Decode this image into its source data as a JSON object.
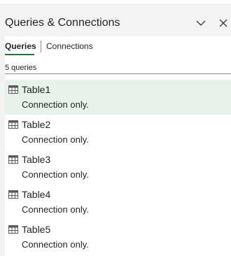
{
  "pane": {
    "title": "Queries & Connections",
    "collapse_icon": "chevron-down-icon",
    "close_icon": "close-icon"
  },
  "tabs": {
    "active": "Queries",
    "items": [
      {
        "label": "Queries"
      },
      {
        "label": "Connections"
      }
    ]
  },
  "query_count": "5 queries",
  "colors": {
    "accent": "#217346",
    "selected_bg": "#e6f2ea",
    "icon": "#5a5a5a"
  },
  "queries": [
    {
      "name": "Table1",
      "description": "Connection only.",
      "icon": "table-icon",
      "selected": true
    },
    {
      "name": "Table2",
      "description": "Connection only.",
      "icon": "table-icon",
      "selected": false
    },
    {
      "name": "Table3",
      "description": "Connection only.",
      "icon": "table-icon",
      "selected": false
    },
    {
      "name": "Table4",
      "description": "Connection only.",
      "icon": "table-icon",
      "selected": false
    },
    {
      "name": "Table5",
      "description": "Connection only.",
      "icon": "table-icon",
      "selected": false
    }
  ]
}
